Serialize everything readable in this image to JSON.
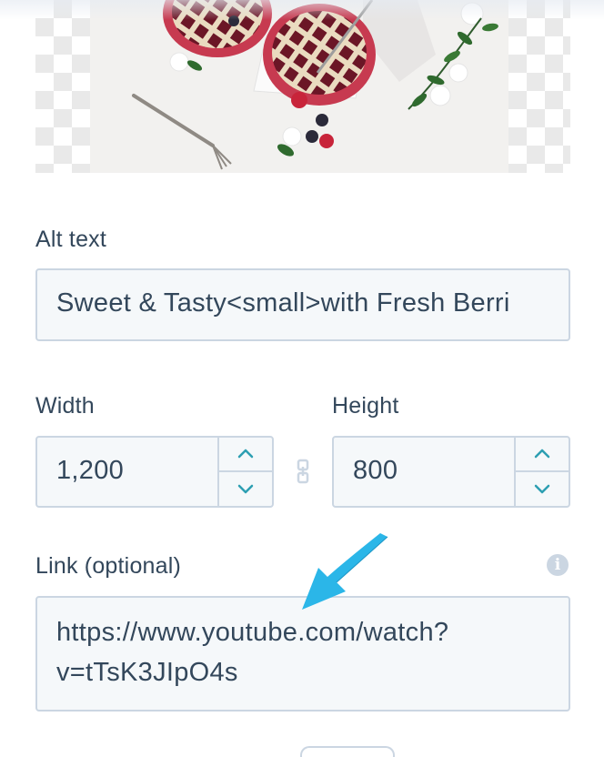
{
  "image": {
    "icon": "image-preview"
  },
  "alt_text": {
    "label": "Alt text",
    "value": "Sweet & Tasty<small>with Fresh Berri"
  },
  "width": {
    "label": "Width",
    "value": "1,200"
  },
  "height": {
    "label": "Height",
    "value": "800"
  },
  "link": {
    "label": "Link (optional)",
    "value_line1": "https://www.youtube.com/watch?",
    "value_line2": "v=tTsK3JIpO4s"
  },
  "colors": {
    "text": "#33475b",
    "field_bg": "#f5f8fa",
    "field_border": "#cbd6e2",
    "stepper_icon": "#2d9fb2",
    "annotation_arrow": "#2bb6e8"
  }
}
